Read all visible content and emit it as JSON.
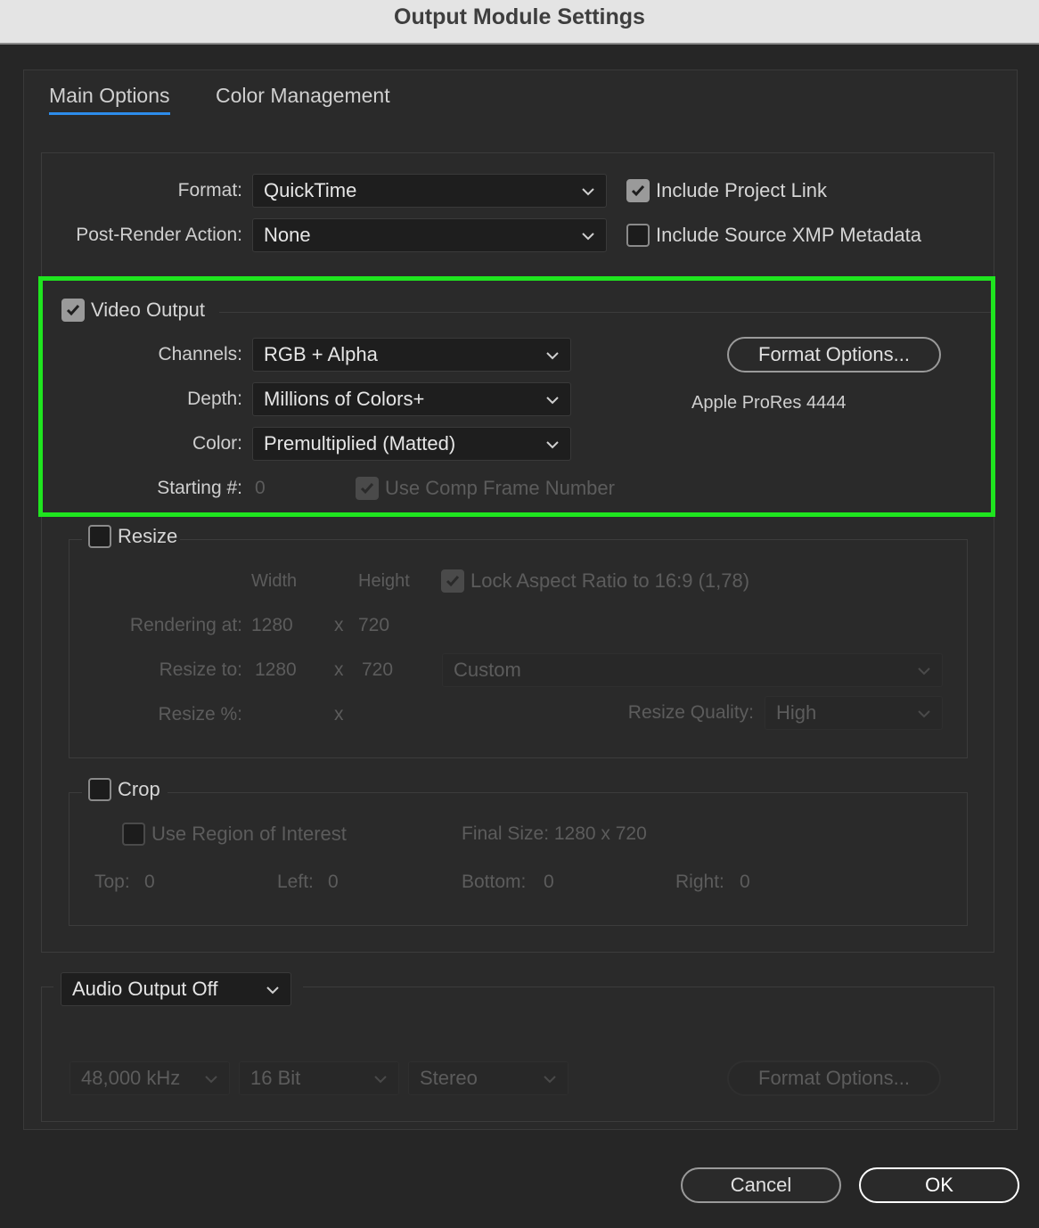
{
  "window": {
    "title": "Output Module Settings"
  },
  "tabs": [
    {
      "label": "Main Options",
      "active": true
    },
    {
      "label": "Color Management",
      "active": false
    }
  ],
  "format": {
    "label": "Format:",
    "value": "QuickTime"
  },
  "post_render": {
    "label": "Post-Render Action:",
    "value": "None"
  },
  "include_project_link": {
    "label": "Include Project Link",
    "checked": true
  },
  "include_xmp": {
    "label": "Include Source XMP Metadata",
    "checked": false
  },
  "video": {
    "label": "Video Output",
    "checked": true,
    "channels": {
      "label": "Channels:",
      "value": "RGB + Alpha"
    },
    "depth": {
      "label": "Depth:",
      "value": "Millions of Colors+"
    },
    "color": {
      "label": "Color:",
      "value": "Premultiplied (Matted)"
    },
    "starting": {
      "label": "Starting #:",
      "value": "0"
    },
    "use_comp_frame": {
      "label": "Use Comp Frame Number",
      "checked": true
    },
    "format_options_button": "Format Options...",
    "codec": "Apple ProRes 4444"
  },
  "resize": {
    "label": "Resize",
    "checked": false,
    "width_header": "Width",
    "height_header": "Height",
    "lock_aspect": {
      "label": "Lock Aspect Ratio to 16:9 (1,78)",
      "checked": true
    },
    "rendering_at": {
      "label": "Rendering at:",
      "width": "1280",
      "x": "x",
      "height": "720"
    },
    "resize_to": {
      "label": "Resize to:",
      "width": "1280",
      "x": "x",
      "height": "720",
      "preset": "Custom"
    },
    "resize_pct": {
      "label": "Resize %:",
      "x": "x"
    },
    "quality": {
      "label": "Resize Quality:",
      "value": "High"
    }
  },
  "crop": {
    "label": "Crop",
    "checked": false,
    "roi": {
      "label": "Use Region of Interest",
      "checked": false
    },
    "final_size": "Final Size: 1280 x 720",
    "top": {
      "label": "Top:",
      "value": "0"
    },
    "left": {
      "label": "Left:",
      "value": "0"
    },
    "bottom": {
      "label": "Bottom:",
      "value": "0"
    },
    "right": {
      "label": "Right:",
      "value": "0"
    }
  },
  "audio": {
    "mode": "Audio Output Off",
    "rate": "48,000 kHz",
    "bits": "16 Bit",
    "channels": "Stereo",
    "format_options_button": "Format Options..."
  },
  "buttons": {
    "cancel": "Cancel",
    "ok": "OK"
  },
  "colors": {
    "highlight": "#1fe51f",
    "tab_underline": "#2d8ceb"
  },
  "icons": [
    "chevron-down-icon",
    "checkmark-icon"
  ]
}
